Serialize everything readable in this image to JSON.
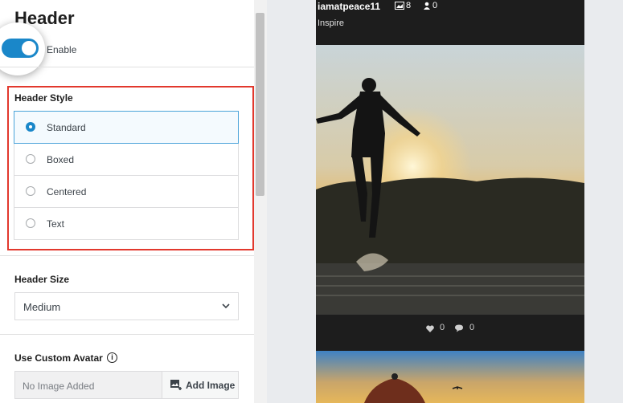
{
  "panel": {
    "title": "Header",
    "enable_label": "Enable",
    "header_style_label": "Header Style",
    "header_style_options": [
      {
        "label": "Standard",
        "selected": true
      },
      {
        "label": "Boxed",
        "selected": false
      },
      {
        "label": "Centered",
        "selected": false
      },
      {
        "label": "Text",
        "selected": false
      }
    ],
    "header_size_label": "Header Size",
    "header_size_value": "Medium",
    "custom_avatar_label": "Use Custom Avatar",
    "avatar_placeholder": "No Image Added",
    "add_image_label": "Add Image"
  },
  "preview": {
    "username": "iamatpeace11",
    "posts_count": "8",
    "followers_count": "0",
    "bio": "Inspire",
    "likes": "0",
    "comments": "0"
  },
  "colors": {
    "accent": "#1a87c9",
    "highlight_border": "#e2382d"
  }
}
